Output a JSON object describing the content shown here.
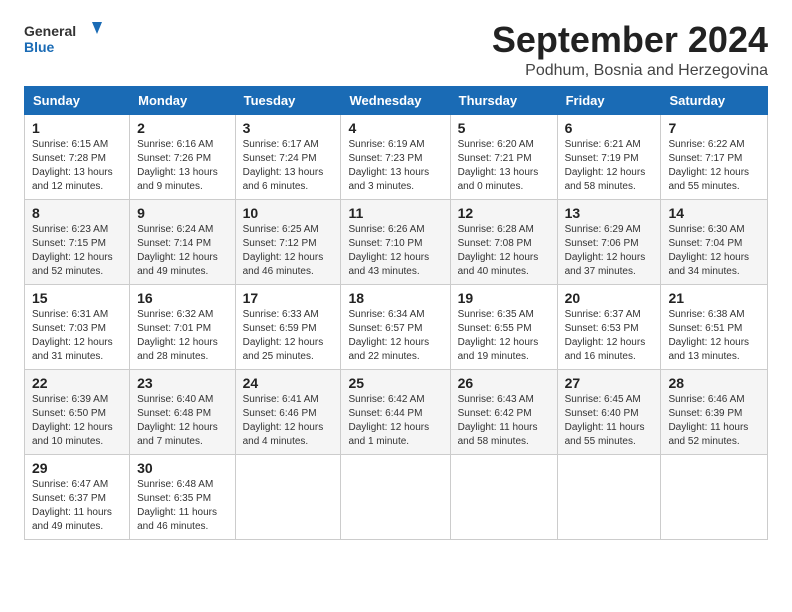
{
  "logo": {
    "line1": "General",
    "line2": "Blue"
  },
  "title": "September 2024",
  "location": "Podhum, Bosnia and Herzegovina",
  "days_of_week": [
    "Sunday",
    "Monday",
    "Tuesday",
    "Wednesday",
    "Thursday",
    "Friday",
    "Saturday"
  ],
  "weeks": [
    [
      {
        "day": "1",
        "sunrise": "Sunrise: 6:15 AM",
        "sunset": "Sunset: 7:28 PM",
        "daylight": "Daylight: 13 hours and 12 minutes."
      },
      {
        "day": "2",
        "sunrise": "Sunrise: 6:16 AM",
        "sunset": "Sunset: 7:26 PM",
        "daylight": "Daylight: 13 hours and 9 minutes."
      },
      {
        "day": "3",
        "sunrise": "Sunrise: 6:17 AM",
        "sunset": "Sunset: 7:24 PM",
        "daylight": "Daylight: 13 hours and 6 minutes."
      },
      {
        "day": "4",
        "sunrise": "Sunrise: 6:19 AM",
        "sunset": "Sunset: 7:23 PM",
        "daylight": "Daylight: 13 hours and 3 minutes."
      },
      {
        "day": "5",
        "sunrise": "Sunrise: 6:20 AM",
        "sunset": "Sunset: 7:21 PM",
        "daylight": "Daylight: 13 hours and 0 minutes."
      },
      {
        "day": "6",
        "sunrise": "Sunrise: 6:21 AM",
        "sunset": "Sunset: 7:19 PM",
        "daylight": "Daylight: 12 hours and 58 minutes."
      },
      {
        "day": "7",
        "sunrise": "Sunrise: 6:22 AM",
        "sunset": "Sunset: 7:17 PM",
        "daylight": "Daylight: 12 hours and 55 minutes."
      }
    ],
    [
      {
        "day": "8",
        "sunrise": "Sunrise: 6:23 AM",
        "sunset": "Sunset: 7:15 PM",
        "daylight": "Daylight: 12 hours and 52 minutes."
      },
      {
        "day": "9",
        "sunrise": "Sunrise: 6:24 AM",
        "sunset": "Sunset: 7:14 PM",
        "daylight": "Daylight: 12 hours and 49 minutes."
      },
      {
        "day": "10",
        "sunrise": "Sunrise: 6:25 AM",
        "sunset": "Sunset: 7:12 PM",
        "daylight": "Daylight: 12 hours and 46 minutes."
      },
      {
        "day": "11",
        "sunrise": "Sunrise: 6:26 AM",
        "sunset": "Sunset: 7:10 PM",
        "daylight": "Daylight: 12 hours and 43 minutes."
      },
      {
        "day": "12",
        "sunrise": "Sunrise: 6:28 AM",
        "sunset": "Sunset: 7:08 PM",
        "daylight": "Daylight: 12 hours and 40 minutes."
      },
      {
        "day": "13",
        "sunrise": "Sunrise: 6:29 AM",
        "sunset": "Sunset: 7:06 PM",
        "daylight": "Daylight: 12 hours and 37 minutes."
      },
      {
        "day": "14",
        "sunrise": "Sunrise: 6:30 AM",
        "sunset": "Sunset: 7:04 PM",
        "daylight": "Daylight: 12 hours and 34 minutes."
      }
    ],
    [
      {
        "day": "15",
        "sunrise": "Sunrise: 6:31 AM",
        "sunset": "Sunset: 7:03 PM",
        "daylight": "Daylight: 12 hours and 31 minutes."
      },
      {
        "day": "16",
        "sunrise": "Sunrise: 6:32 AM",
        "sunset": "Sunset: 7:01 PM",
        "daylight": "Daylight: 12 hours and 28 minutes."
      },
      {
        "day": "17",
        "sunrise": "Sunrise: 6:33 AM",
        "sunset": "Sunset: 6:59 PM",
        "daylight": "Daylight: 12 hours and 25 minutes."
      },
      {
        "day": "18",
        "sunrise": "Sunrise: 6:34 AM",
        "sunset": "Sunset: 6:57 PM",
        "daylight": "Daylight: 12 hours and 22 minutes."
      },
      {
        "day": "19",
        "sunrise": "Sunrise: 6:35 AM",
        "sunset": "Sunset: 6:55 PM",
        "daylight": "Daylight: 12 hours and 19 minutes."
      },
      {
        "day": "20",
        "sunrise": "Sunrise: 6:37 AM",
        "sunset": "Sunset: 6:53 PM",
        "daylight": "Daylight: 12 hours and 16 minutes."
      },
      {
        "day": "21",
        "sunrise": "Sunrise: 6:38 AM",
        "sunset": "Sunset: 6:51 PM",
        "daylight": "Daylight: 12 hours and 13 minutes."
      }
    ],
    [
      {
        "day": "22",
        "sunrise": "Sunrise: 6:39 AM",
        "sunset": "Sunset: 6:50 PM",
        "daylight": "Daylight: 12 hours and 10 minutes."
      },
      {
        "day": "23",
        "sunrise": "Sunrise: 6:40 AM",
        "sunset": "Sunset: 6:48 PM",
        "daylight": "Daylight: 12 hours and 7 minutes."
      },
      {
        "day": "24",
        "sunrise": "Sunrise: 6:41 AM",
        "sunset": "Sunset: 6:46 PM",
        "daylight": "Daylight: 12 hours and 4 minutes."
      },
      {
        "day": "25",
        "sunrise": "Sunrise: 6:42 AM",
        "sunset": "Sunset: 6:44 PM",
        "daylight": "Daylight: 12 hours and 1 minute."
      },
      {
        "day": "26",
        "sunrise": "Sunrise: 6:43 AM",
        "sunset": "Sunset: 6:42 PM",
        "daylight": "Daylight: 11 hours and 58 minutes."
      },
      {
        "day": "27",
        "sunrise": "Sunrise: 6:45 AM",
        "sunset": "Sunset: 6:40 PM",
        "daylight": "Daylight: 11 hours and 55 minutes."
      },
      {
        "day": "28",
        "sunrise": "Sunrise: 6:46 AM",
        "sunset": "Sunset: 6:39 PM",
        "daylight": "Daylight: 11 hours and 52 minutes."
      }
    ],
    [
      {
        "day": "29",
        "sunrise": "Sunrise: 6:47 AM",
        "sunset": "Sunset: 6:37 PM",
        "daylight": "Daylight: 11 hours and 49 minutes."
      },
      {
        "day": "30",
        "sunrise": "Sunrise: 6:48 AM",
        "sunset": "Sunset: 6:35 PM",
        "daylight": "Daylight: 11 hours and 46 minutes."
      },
      null,
      null,
      null,
      null,
      null
    ]
  ]
}
